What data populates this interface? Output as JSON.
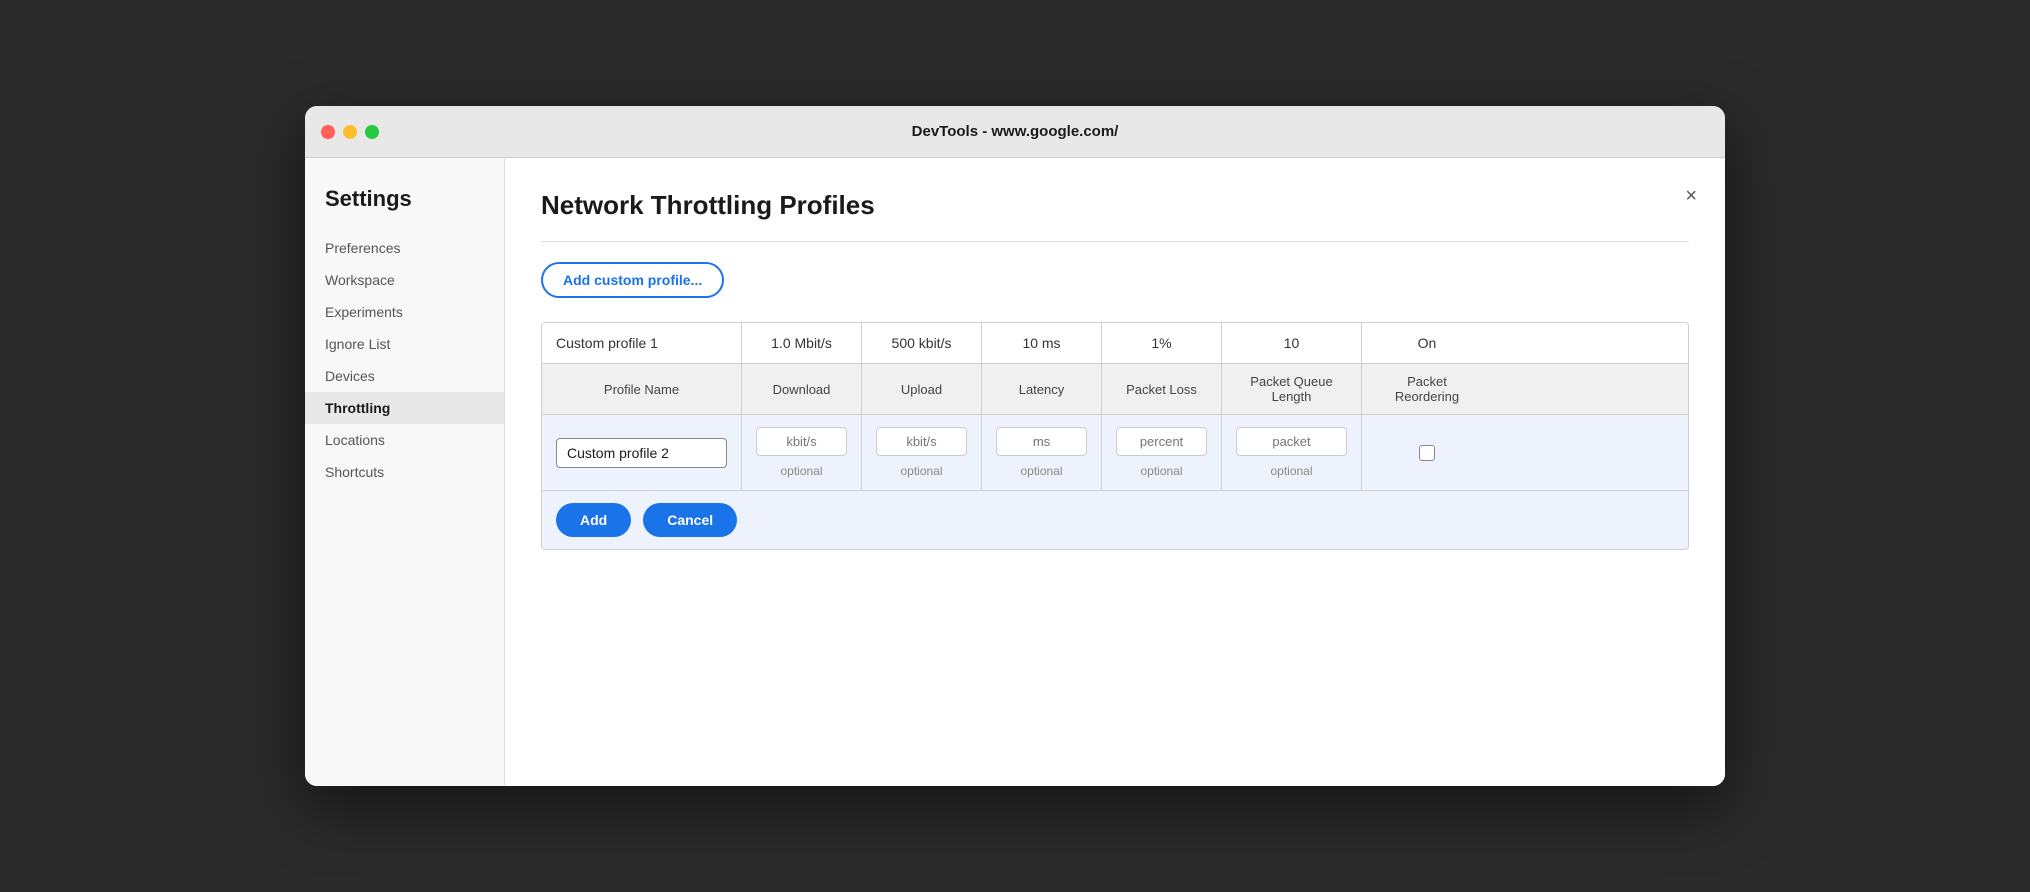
{
  "window": {
    "title": "DevTools - www.google.com/"
  },
  "sidebar": {
    "heading": "Settings",
    "items": [
      {
        "id": "preferences",
        "label": "Preferences",
        "active": false
      },
      {
        "id": "workspace",
        "label": "Workspace",
        "active": false
      },
      {
        "id": "experiments",
        "label": "Experiments",
        "active": false
      },
      {
        "id": "ignore-list",
        "label": "Ignore List",
        "active": false
      },
      {
        "id": "devices",
        "label": "Devices",
        "active": false
      },
      {
        "id": "throttling",
        "label": "Throttling",
        "active": true
      },
      {
        "id": "locations",
        "label": "Locations",
        "active": false
      },
      {
        "id": "shortcuts",
        "label": "Shortcuts",
        "active": false
      }
    ]
  },
  "main": {
    "page_title": "Network Throttling Profiles",
    "add_button_label": "Add custom profile...",
    "close_icon": "×",
    "table": {
      "existing_profile": {
        "name": "Custom profile 1",
        "download": "1.0 Mbit/s",
        "upload": "500 kbit/s",
        "latency": "10 ms",
        "packet_loss": "1%",
        "packet_queue_length": "10",
        "packet_reordering": "On"
      },
      "headers": {
        "name": "Profile Name",
        "download": "Download",
        "upload": "Upload",
        "latency": "Latency",
        "packet_loss": "Packet Loss",
        "packet_queue_length": "Packet Queue Length",
        "packet_reordering": "Packet Reordering"
      },
      "new_profile": {
        "name_value": "Custom profile 2",
        "name_placeholder": "",
        "download_placeholder": "kbit/s",
        "upload_placeholder": "kbit/s",
        "latency_placeholder": "ms",
        "packet_loss_placeholder": "percent",
        "packet_queue_placeholder": "packet",
        "optional_label": "optional"
      }
    },
    "buttons": {
      "add": "Add",
      "cancel": "Cancel"
    }
  }
}
